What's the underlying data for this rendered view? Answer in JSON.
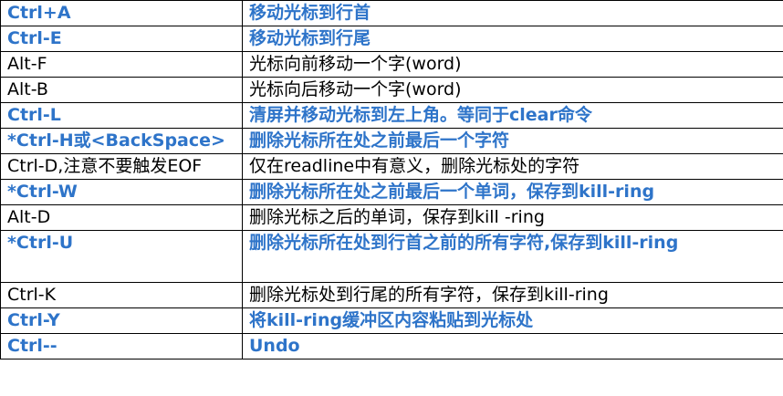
{
  "colors": {
    "highlight_text": "#2e74c9",
    "normal_text": "#000000",
    "border": "#000000"
  },
  "rows": [
    {
      "key": "Ctrl+A",
      "desc": "移动光标到行首",
      "highlight": true
    },
    {
      "key": "Ctrl-E",
      "desc": "移动光标到行尾",
      "highlight": true
    },
    {
      "key": "Alt-F",
      "desc": "光标向前移动一个字(word)",
      "highlight": false
    },
    {
      "key": "Alt-B",
      "desc": "光标向后移动一个字(word)",
      "highlight": false
    },
    {
      "key": "Ctrl-L",
      "desc": "清屏并移动光标到左上角。等同于clear命令",
      "highlight": true
    },
    {
      "key": "*Ctrl-H或<BackSpace>",
      "desc": "删除光标所在处之前最后一个字符",
      "highlight": true
    },
    {
      "key": "Ctrl-D,注意不要触发EOF",
      "desc": "仅在readline中有意义，删除光标处的字符",
      "highlight": false
    },
    {
      "key": "*Ctrl-W",
      "desc": "删除光标所在处之前最后一个单词，保存到kill-ring",
      "highlight": true
    },
    {
      "key": "Alt-D",
      "desc": "删除光标之后的单词，保存到kill -ring",
      "highlight": false
    },
    {
      "key": "*Ctrl-U",
      "desc": "删除光标所在处到行首之前的所有字符,保存到kill-ring",
      "highlight": true
    },
    {
      "key": "Ctrl-K",
      "desc": "删除光标处到行尾的所有字符，保存到kill-ring",
      "highlight": false
    },
    {
      "key": "Ctrl-Y",
      "desc": "将kill-ring缓冲区内容粘贴到光标处",
      "highlight": true
    },
    {
      "key": "Ctrl--",
      "desc": "Undo",
      "highlight": true
    }
  ]
}
